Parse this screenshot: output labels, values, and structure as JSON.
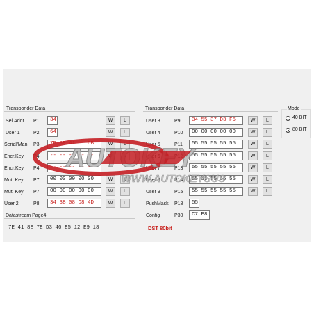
{
  "left": {
    "title": "Transponder Data",
    "rows": [
      {
        "label": "Sel.Addr.",
        "page": "P1",
        "value": "34",
        "style": "red",
        "w": "W",
        "l": "L"
      },
      {
        "label": "User 1",
        "page": "P2",
        "value": "64",
        "style": "red",
        "w": "W",
        "l": "L"
      },
      {
        "label": "Serial/Man.",
        "page": "P3",
        "value": "7E 8E 41    DB",
        "style": "red",
        "w": "W",
        "l": "L"
      },
      {
        "label": "Encr.Key",
        "page": "P4",
        "value": "-- -- -- -- --",
        "style": "red",
        "w": "W",
        "l": "L"
      },
      {
        "label": "Encr.Key",
        "page": "P4",
        "value": "-- -- -- -- --",
        "style": "red",
        "w": "",
        "l": ""
      },
      {
        "label": "Mut. Key",
        "page": "P7",
        "value": "00 00 00 00 00",
        "style": "dark",
        "w": "W",
        "l": "L"
      },
      {
        "label": "Mut. Key",
        "page": "P7",
        "value": "00 00 00 00 00",
        "style": "dark",
        "w": "W",
        "l": "L"
      },
      {
        "label": "User 2",
        "page": "P8",
        "value": "34 3B 08 D8 4D",
        "style": "red",
        "w": "W",
        "l": "L"
      }
    ],
    "datastream_label": "Datastream Page4",
    "datastream_value": "7E 41 8E 7E D3 40 E5 12 E9 18"
  },
  "right": {
    "title": "Transponder Data",
    "rows": [
      {
        "label": "User 3",
        "page": "P9",
        "value": "34 55 37 D3 F6",
        "style": "red",
        "w": "W",
        "l": "L"
      },
      {
        "label": "User 4",
        "page": "P10",
        "value": "00 00 00 00 00",
        "style": "dark",
        "w": "W",
        "l": "L"
      },
      {
        "label": "User 5",
        "page": "P11",
        "value": "55 55 55 55 55",
        "style": "dark",
        "w": "W",
        "l": "L"
      },
      {
        "label": "User 6",
        "page": "P12",
        "value": "55 55 55 55 55",
        "style": "dark",
        "w": "W",
        "l": "L"
      },
      {
        "label": "User 7",
        "page": "P13",
        "value": "55 55 55 55 55",
        "style": "dark",
        "w": "W",
        "l": "L"
      },
      {
        "label": "User 8",
        "page": "P14",
        "value": "55 55 55 55 55",
        "style": "dark",
        "w": "W",
        "l": "L"
      },
      {
        "label": "User 9",
        "page": "P15",
        "value": "55 55 55 55 55",
        "style": "dark",
        "w": "W",
        "l": "L"
      }
    ],
    "pushmask_label": "PushMask",
    "pushmask_page": "P18",
    "pushmask_value": "55",
    "config_label": "Config",
    "config_page": "P30",
    "config_value": "C7 E8",
    "dst_label": "DST 80bit"
  },
  "mode": {
    "title": "Mode",
    "options": [
      "40 BIT",
      "80 BIT"
    ],
    "selected": "80 BIT"
  },
  "toolbar": {
    "read_icon": "key-read-icon",
    "write_icon": "key-write-icon"
  },
  "watermark": {
    "brand": "AUTOKEY",
    "url": "WWW.AUTOKEYSUS"
  },
  "colors": {
    "accent_red": "#c8201c",
    "panel": "#f0f0f0",
    "read_green": "#2e8b2e",
    "write_magenta": "#d42ad4"
  }
}
